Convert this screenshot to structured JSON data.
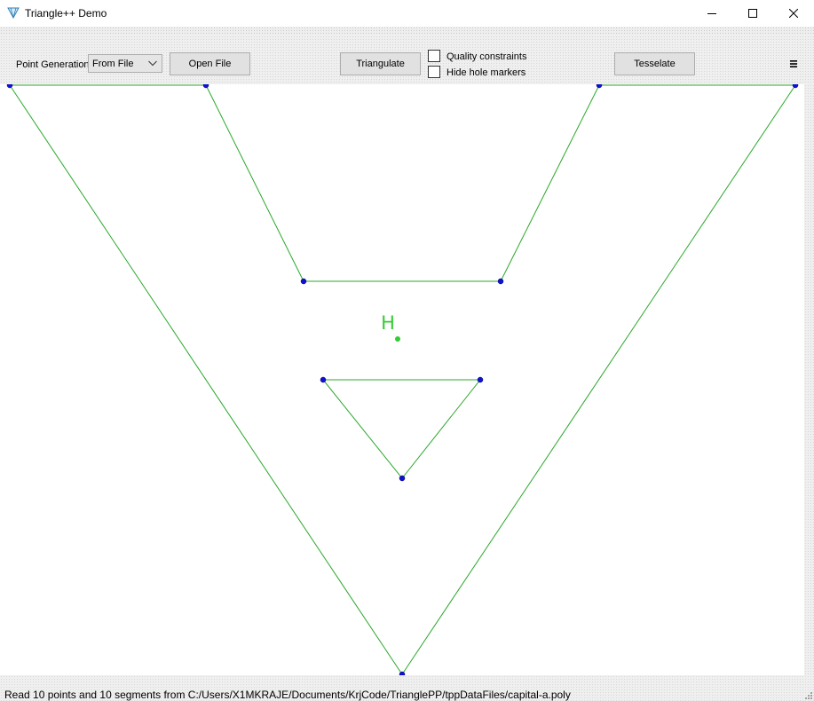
{
  "window": {
    "title": "Triangle++ Demo",
    "icons": {
      "app": "triangle-app-icon",
      "minimize": "minimize-icon",
      "maximize": "maximize-icon",
      "close": "close-icon",
      "menu": "hamburger-menu-icon",
      "size_grip": "size-grip-icon"
    }
  },
  "toolbar": {
    "point_generation_label": "Point Generation",
    "point_generation_value": "From File",
    "open_file_label": "Open File",
    "triangulate_label": "Triangulate",
    "quality_constraints_label": "Quality constraints",
    "quality_constraints_checked": false,
    "hide_hole_markers_label": "Hide hole markers",
    "hide_hole_markers_checked": false,
    "tesselate_label": "Tesselate"
  },
  "canvas": {
    "hole_marker_label": "H",
    "colors": {
      "segment": "#2aa82a",
      "vertex": "#1010d0",
      "hole": "#33cc33",
      "background": "#ffffff"
    }
  },
  "status": {
    "message": "Read 10 points and 10 segments from C:/Users/X1MKRAJE/Documents/KrjCode/TrianglePP/tppDataFiles/capital-a.poly"
  }
}
